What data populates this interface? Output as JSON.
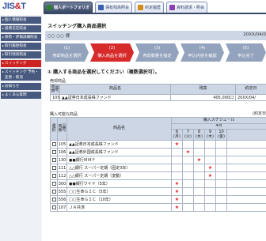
{
  "header": {
    "logo_main": "JIS&T",
    "logo_part1": "JIS",
    "logo_amp": "&",
    "logo_part2": "T",
    "tabs": [
      {
        "label": "個人ポートフォリオ",
        "icon": "portfolio-icon",
        "color": "#2e7d32"
      },
      {
        "label": "保有残高照会",
        "icon": "balance-icon",
        "color": "#3a5fb0"
      },
      {
        "label": "約定履歴",
        "icon": "history-icon",
        "color": "#d48a1a"
      },
      {
        "label": "資料請求・照会",
        "icon": "document-icon",
        "color": "#8a3fb0"
      }
    ]
  },
  "sidebar": {
    "items": [
      {
        "label": "個人情報照会"
      },
      {
        "label": "投資信託照会"
      },
      {
        "label": "保有・評価詳細照会"
      },
      {
        "label": "取引履歴照会"
      },
      {
        "label": "取引残高照会"
      },
      {
        "label": "スイッチング",
        "active": true
      },
      {
        "label": "スイッチング 予約・変更・取消"
      },
      {
        "label": "お知らせ"
      },
      {
        "label": "よくある質問"
      }
    ]
  },
  "page": {
    "title": "スイッチング購入商品選択",
    "customer_name": "○○ ○○ 様",
    "date": "20XX/04/0"
  },
  "steps": [
    {
      "number": "(1)",
      "label": "売却商品を選択",
      "active": false
    },
    {
      "number": "(2)",
      "label": "購入商品を選択",
      "active": true
    },
    {
      "number": "(3)",
      "label": "売却数量を指定",
      "active": false
    },
    {
      "number": "(4)",
      "label": "申込内容を確認",
      "active": false
    },
    {
      "number": "(5)",
      "label": "申込完了",
      "active": false
    }
  ],
  "section": {
    "title": "① 購入する商品を選択してください（複数選択可）。"
  },
  "sell": {
    "caption": "売却商品",
    "headers": {
      "code": "商品番号",
      "name": "商品名",
      "balance": "残高",
      "date": "約定日"
    },
    "rows": [
      {
        "code": "105",
        "name": "▲▲証券日本成長株ファンド",
        "balance": "405,000口",
        "date": "20XX/04/"
      }
    ]
  },
  "buy": {
    "caption": "購入可能な商品",
    "control_label": "(約定日",
    "headers": {
      "select": "選択",
      "code": "商品番号",
      "name": "商品名",
      "schedule": "購入スケジュール",
      "month": "4月",
      "days": [
        "6 (月)",
        "7 (火)",
        "8 (水)",
        "9 (木)",
        "10 (金)"
      ]
    },
    "rows": [
      {
        "code": "105",
        "name": "▲▲証券日本成長株ファンド",
        "marks": [
          true,
          false,
          false,
          false,
          false
        ]
      },
      {
        "code": "106",
        "name": "▲▲証券外国成長株ファンド",
        "marks": [
          false,
          true,
          false,
          false,
          false
        ]
      },
      {
        "code": "130",
        "name": "●●銀行ＭＭＦ",
        "marks": [
          false,
          false,
          true,
          false,
          false
        ]
      },
      {
        "code": "111",
        "name": "△△銀行 スーパー定期（固定3年）",
        "marks": [
          false,
          false,
          false,
          true,
          false
        ]
      },
      {
        "code": "112",
        "name": "△△銀行 スーパー定期（変動）",
        "marks": [
          false,
          false,
          false,
          true,
          false
        ]
      },
      {
        "code": "300",
        "name": "●●銀行ワイド（5年）",
        "marks": [
          true,
          false,
          false,
          false,
          false
        ]
      },
      {
        "code": "555",
        "name": "□□生命ＧＩＣ（5年）",
        "marks": [
          true,
          false,
          false,
          false,
          false
        ]
      },
      {
        "code": "556",
        "name": "□□生命ＧＩＣ（10年）",
        "marks": [
          true,
          false,
          false,
          false,
          false
        ]
      },
      {
        "code": "107",
        "name": "ＪＡ共済",
        "marks": [
          true,
          false,
          false,
          false,
          false
        ]
      }
    ],
    "mark_symbol": "★"
  }
}
